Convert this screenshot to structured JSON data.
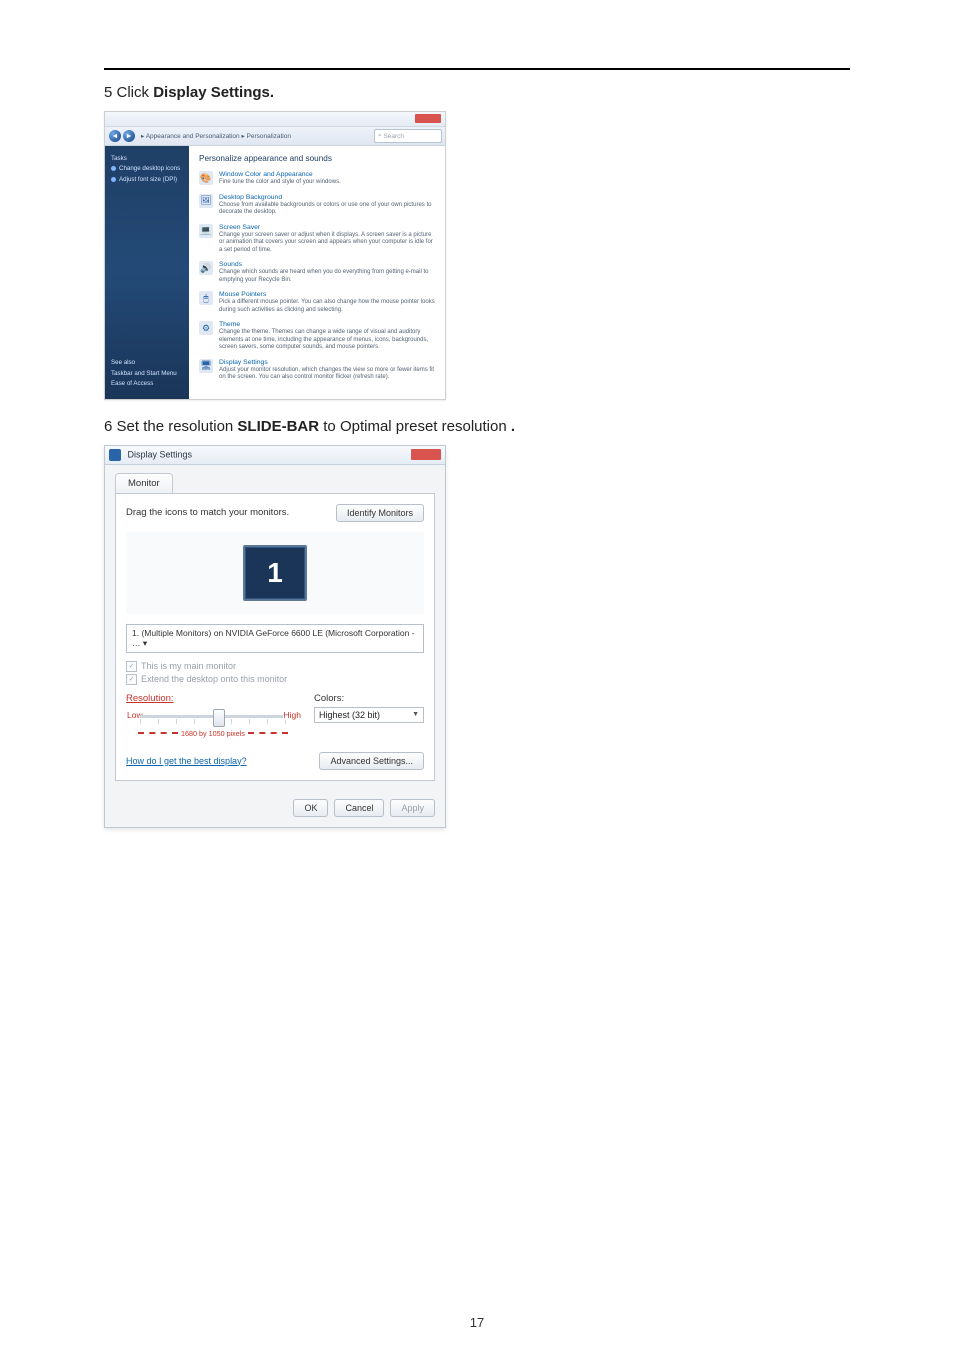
{
  "page_number": "17",
  "step1": {
    "num": "5",
    "pre": " Click ",
    "bold": "Display Settings."
  },
  "step2": {
    "num": "6",
    "pre": " Set the resolution ",
    "bold": "SLIDE-BAR",
    "mid": " to  Optimal preset resolution ",
    "dot": "."
  },
  "personalization": {
    "back_arrow": "◄",
    "fwd_arrow": "►",
    "breadcrumb": "▸ Appearance and Personalization ▸ Personalization",
    "search_placeholder": "Search",
    "sidebar_top": {
      "heading": "Tasks",
      "item1": "Change desktop icons",
      "item2": "Adjust font size (DPI)"
    },
    "sidebar_bottom": {
      "item1": "See also",
      "item2": "Taskbar and Start Menu",
      "item3": "Ease of Access"
    },
    "heading": "Personalize appearance and sounds",
    "items": [
      {
        "icon": "🎨",
        "title": "Window Color and Appearance",
        "desc": "Fine tune the color and style of your windows."
      },
      {
        "icon": "🖼",
        "title": "Desktop Background",
        "desc": "Choose from available backgrounds or colors or use one of your own pictures to decorate the desktop."
      },
      {
        "icon": "💻",
        "title": "Screen Saver",
        "desc": "Change your screen saver or adjust when it displays. A screen saver is a picture or animation that covers your screen and appears when your computer is idle for a set period of time."
      },
      {
        "icon": "🔊",
        "title": "Sounds",
        "desc": "Change which sounds are heard when you do everything from getting e-mail to emptying your Recycle Bin."
      },
      {
        "icon": "🖱",
        "title": "Mouse Pointers",
        "desc": "Pick a different mouse pointer. You can also change how the mouse pointer looks during such activities as clicking and selecting."
      },
      {
        "icon": "⚙",
        "title": "Theme",
        "desc": "Change the theme. Themes can change a wide range of visual and auditory elements at one time, including the appearance of menus, icons, backgrounds, screen savers, some computer sounds, and mouse pointers."
      },
      {
        "icon": "🖥",
        "title": "Display Settings",
        "desc": "Adjust your monitor resolution, which changes the view so more or fewer items fit on the screen. You can also control monitor flicker (refresh rate)."
      }
    ]
  },
  "display_settings": {
    "title": "Display Settings",
    "tab": "Monitor",
    "drag_text": "Drag the icons to match your monitors.",
    "identify_btn": "Identify Monitors",
    "monitor_number": "1",
    "monitor_select": "1. (Multiple Monitors) on NVIDIA GeForce 6600 LE (Microsoft Corporation - …  ▾",
    "chk1": "This is my main monitor",
    "chk2": "Extend the desktop onto this monitor",
    "resolution_label": "Resolution:",
    "res_low": "Low",
    "res_high": "High",
    "res_caption": "1680 by 1050 pixels",
    "colors_label": "Colors:",
    "colors_value": "Highest (32 bit)",
    "help_link": "How do I get the best display?",
    "advanced_btn": "Advanced Settings...",
    "ok": "OK",
    "cancel": "Cancel",
    "apply": "Apply"
  }
}
